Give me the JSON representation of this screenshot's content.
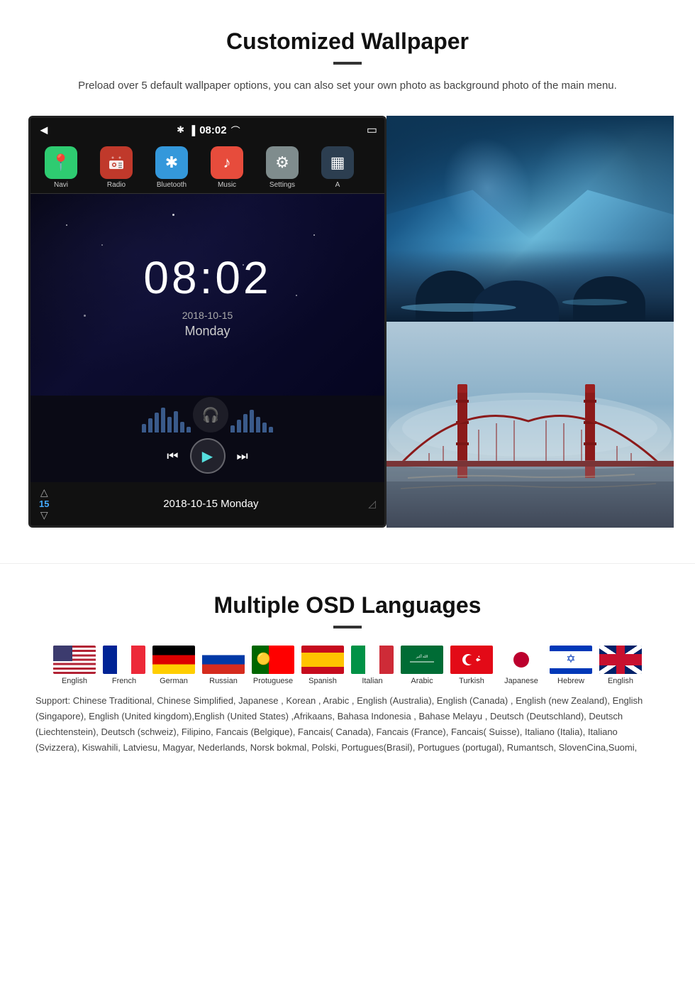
{
  "wallpaper_section": {
    "title": "Customized Wallpaper",
    "description": "Preload over 5 default wallpaper options, you can also set your own photo as background photo of the main menu.",
    "screen": {
      "time": "08:02",
      "date": "2018-10-15",
      "day": "Monday",
      "bottom_date": "2018-10-15  Monday",
      "volume": "15",
      "apps": [
        {
          "label": "Navi",
          "icon": "📍"
        },
        {
          "label": "Radio",
          "icon": "📻"
        },
        {
          "label": "Bluetooth",
          "icon": "✱"
        },
        {
          "label": "Music",
          "icon": "🎵"
        },
        {
          "label": "Settings",
          "icon": "⚙"
        },
        {
          "label": "A",
          "icon": "▦"
        }
      ]
    }
  },
  "osd_section": {
    "title": "Multiple OSD Languages",
    "flags": [
      {
        "label": "English",
        "css_class": "flag-us"
      },
      {
        "label": "French",
        "css_class": "flag-fr"
      },
      {
        "label": "German",
        "css_class": "flag-de"
      },
      {
        "label": "Russian",
        "css_class": "flag-ru"
      },
      {
        "label": "Protuguese",
        "css_class": "flag-pt"
      },
      {
        "label": "Spanish",
        "css_class": "flag-es"
      },
      {
        "label": "Italian",
        "css_class": "flag-it"
      },
      {
        "label": "Arabic",
        "css_class": "flag-sa"
      },
      {
        "label": "Turkish",
        "css_class": "flag-tr"
      },
      {
        "label": "Japanese",
        "css_class": "flag-jp"
      },
      {
        "label": "Hebrew",
        "css_class": "flag-il"
      },
      {
        "label": "English",
        "css_class": "flag-gb"
      }
    ],
    "support_text": "Support: Chinese Traditional, Chinese Simplified, Japanese , Korean , Arabic , English (Australia), English (Canada) , English (new Zealand), English (Singapore), English (United kingdom),English (United States) ,Afrikaans, Bahasa Indonesia , Bahase Melayu , Deutsch (Deutschland), Deutsch (Liechtenstein), Deutsch (schweiz), Filipino, Fancais (Belgique), Fancais( Canada), Fancais (France), Fancais( Suisse), Italiano (Italia), Italiano (Svizzera), Kiswahili, Latviesu, Magyar, Nederlands, Norsk bokmal, Polski, Portugues(Brasil), Portugues (portugal), Rumantsch, SlovenCina,Suomi,"
  }
}
